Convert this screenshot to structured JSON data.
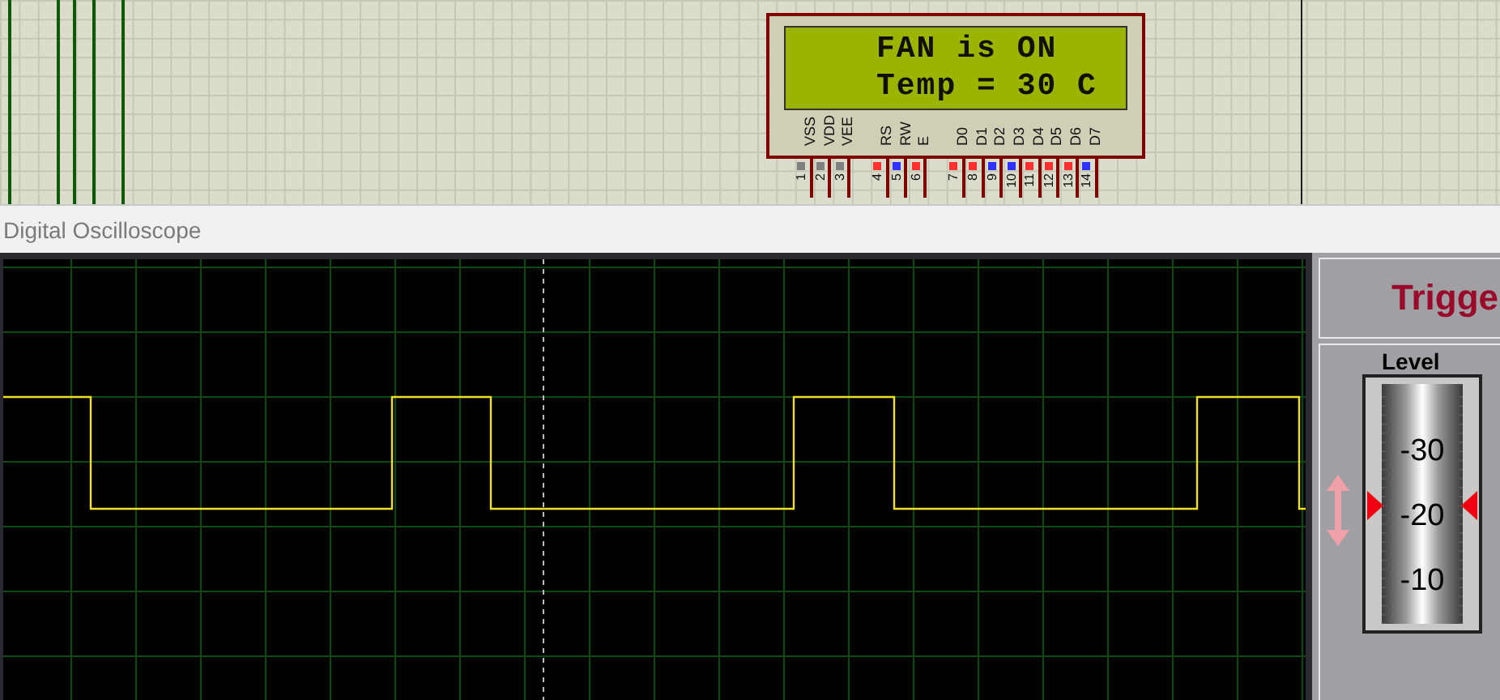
{
  "lcd": {
    "lines": [
      "FAN is ON",
      "Temp = 30 C"
    ],
    "pin_groups": [
      [
        {
          "label": "VSS",
          "number": "1",
          "color": "#808080"
        },
        {
          "label": "VDD",
          "number": "2",
          "color": "#808080"
        },
        {
          "label": "VEE",
          "number": "3",
          "color": "#808080"
        }
      ],
      [
        {
          "label": "RS",
          "number": "4",
          "color": "#ff3030"
        },
        {
          "label": "RW",
          "number": "5",
          "color": "#3030ff"
        },
        {
          "label": "E",
          "number": "6",
          "color": "#ff3030"
        }
      ],
      [
        {
          "label": "D0",
          "number": "7",
          "color": "#ff3030"
        },
        {
          "label": "D1",
          "number": "8",
          "color": "#ff3030"
        },
        {
          "label": "D2",
          "number": "9",
          "color": "#3030ff"
        },
        {
          "label": "D3",
          "number": "10",
          "color": "#3030ff"
        },
        {
          "label": "D4",
          "number": "11",
          "color": "#ff3030"
        },
        {
          "label": "D5",
          "number": "12",
          "color": "#ff3030"
        },
        {
          "label": "D6",
          "number": "13",
          "color": "#ff3030"
        },
        {
          "label": "D7",
          "number": "14",
          "color": "#3030ff"
        }
      ]
    ]
  },
  "window": {
    "title": "Digital Oscilloscope"
  },
  "trigger": {
    "title": "Trigge",
    "level_label": "Level",
    "dial_marks": [
      "-30",
      "-20",
      "-10"
    ]
  }
}
